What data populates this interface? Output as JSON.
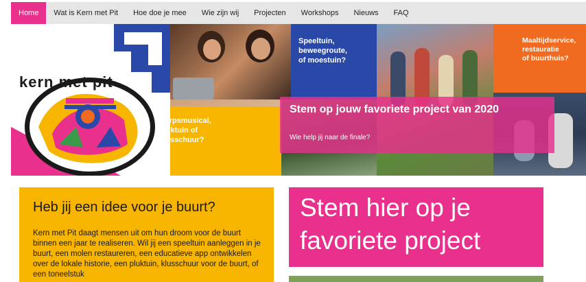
{
  "nav": {
    "items": [
      {
        "label": "Home",
        "active": true
      },
      {
        "label": "Wat is Kern met Pit",
        "active": false
      },
      {
        "label": "Hoe doe je mee",
        "active": false
      },
      {
        "label": "Wie zijn wij",
        "active": false
      },
      {
        "label": "Projecten",
        "active": false
      },
      {
        "label": "Workshops",
        "active": false
      },
      {
        "label": "Nieuws",
        "active": false
      },
      {
        "label": "FAQ",
        "active": false
      }
    ]
  },
  "hero": {
    "logo_text": "kern met pit",
    "panel_blue": [
      "Speeltuin,",
      "beweegroute,",
      "of moestuin?"
    ],
    "panel_orange": [
      "Maaltijdservice,",
      "restauratie",
      "of buurthuis?"
    ],
    "panel_yellow": [
      "Dorpsmusical,",
      "pluktuin of",
      "klusschuur?"
    ],
    "banner_title": "Stem op jouw favoriete project van 2020",
    "banner_sub": "Wie help jij naar de finale?"
  },
  "idea": {
    "title": "Heb jij een idee voor je buurt?",
    "body": "Kern met Pit daagt mensen uit om hun droom voor de buurt binnen een jaar te realiseren. Wil jij een speeltuin aanleggen in je buurt, een molen restaureren, een educatieve app ontwikkelen over de lokale historie, een pluktuin, klusschuur voor de buurt, of een toneelstuk"
  },
  "vote": {
    "title": "Stem hier op je favoriete project"
  },
  "colors": {
    "pink": "#e8308c",
    "yellow": "#f7b500",
    "blue": "#2a48a8",
    "orange": "#f06a1f",
    "nav_bg": "#e6e6e6"
  }
}
